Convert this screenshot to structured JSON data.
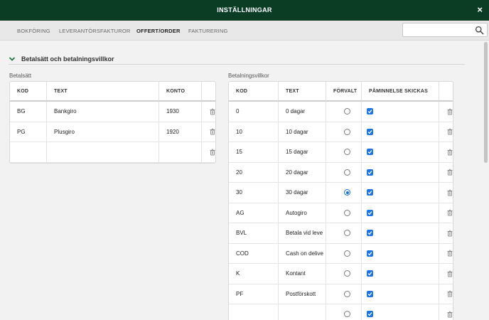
{
  "dialog": {
    "title": "INSTÄLLNINGAR",
    "close_label": "×"
  },
  "tabs": [
    {
      "label": "BOKFÖRING"
    },
    {
      "label": "LEVERANTÖRSFAKTUROR"
    },
    {
      "label": "OFFERT/ORDER",
      "active": true
    },
    {
      "label": "FAKTURERING"
    }
  ],
  "search": {
    "value": "",
    "placeholder": ""
  },
  "section": {
    "title": "Betalsätt och betalningsvillkor"
  },
  "betalsatt": {
    "label": "Betalsätt",
    "columns": [
      "KOD",
      "TEXT",
      "KONTO"
    ],
    "rows": [
      {
        "kod": "BG",
        "text": "Bankgiro",
        "konto": "1930"
      },
      {
        "kod": "PG",
        "text": "Plusgiro",
        "konto": "1920"
      },
      {
        "kod": "",
        "text": "",
        "konto": ""
      }
    ]
  },
  "villkor": {
    "label": "Betalningsvillkor",
    "columns": [
      "KOD",
      "TEXT",
      "FÖRVALT",
      "PÅMINNELSE SKICKAS"
    ],
    "rows": [
      {
        "kod": "0",
        "text": "0 dagar",
        "default": false,
        "reminder": true
      },
      {
        "kod": "10",
        "text": "10 dagar",
        "default": false,
        "reminder": true
      },
      {
        "kod": "15",
        "text": "15 dagar",
        "default": false,
        "reminder": true
      },
      {
        "kod": "20",
        "text": "20 dagar",
        "default": false,
        "reminder": true
      },
      {
        "kod": "30",
        "text": "30 dagar",
        "default": true,
        "reminder": true
      },
      {
        "kod": "AG",
        "text": "Autogiro",
        "default": false,
        "reminder": true
      },
      {
        "kod": "BVL",
        "text": "Betala vid leve",
        "default": false,
        "reminder": true
      },
      {
        "kod": "COD",
        "text": "Cash on delive",
        "default": false,
        "reminder": true
      },
      {
        "kod": "K",
        "text": "Kontant",
        "default": false,
        "reminder": true
      },
      {
        "kod": "PF",
        "text": "Postförskott",
        "default": false,
        "reminder": true
      },
      {
        "kod": "",
        "text": "",
        "default": false,
        "reminder": true
      }
    ]
  },
  "colors": {
    "header": "#0b3d25",
    "accent": "#1a73e8",
    "chevron": "#1f7a3f"
  },
  "icons": [
    "close-icon",
    "search-icon",
    "chevron-down-icon",
    "trash-icon",
    "checkbox-icon"
  ]
}
